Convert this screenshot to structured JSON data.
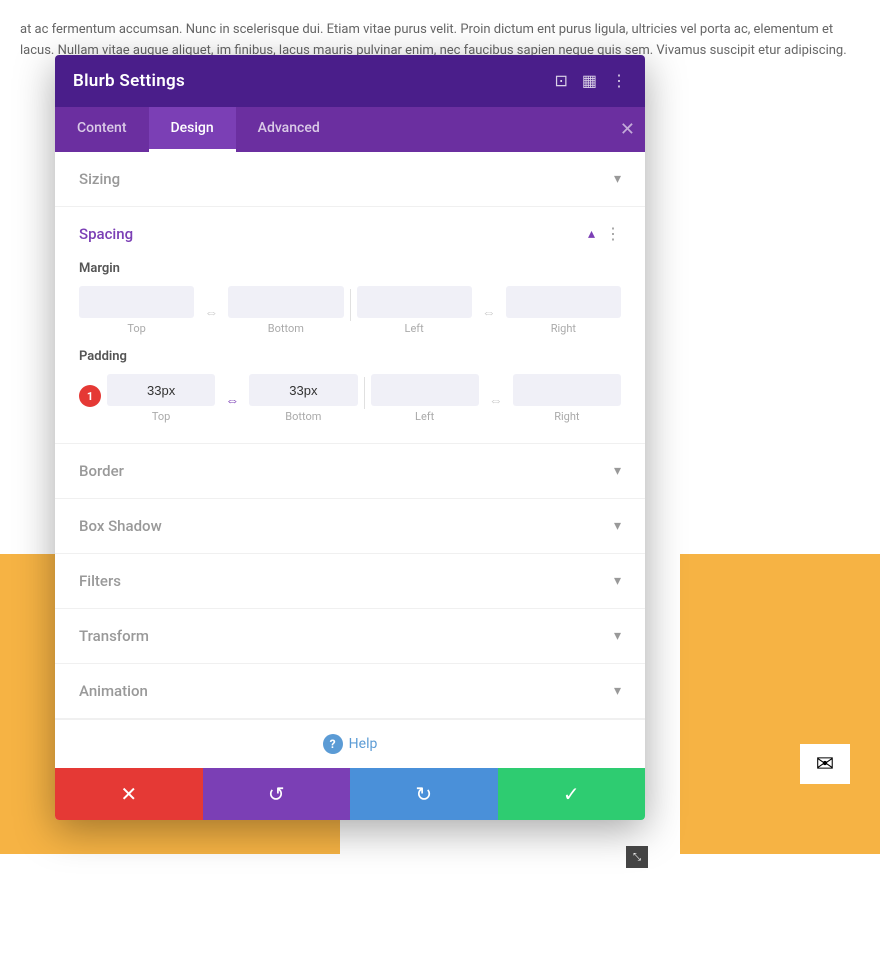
{
  "page": {
    "bg_text": "at ac fermentum accumsan. Nunc in scelerisque dui. Etiam vitae purus velit. Proin dictum ent purus ligula, ultricies vel porta ac, elementum et lacus. Nullam vitae augue aliquet, im finibus, lacus mauris pulvinar enim, nec faucibus sapien neque quis sem. Vivamus suscipit etur adipiscing."
  },
  "modal": {
    "title": "Blurb Settings",
    "tabs": [
      {
        "label": "Content",
        "active": false
      },
      {
        "label": "Design",
        "active": true
      },
      {
        "label": "Advanced",
        "active": false
      }
    ],
    "sections": [
      {
        "label": "Sizing",
        "expanded": false
      },
      {
        "label": "Spacing",
        "expanded": true
      },
      {
        "label": "Border",
        "expanded": false
      },
      {
        "label": "Box Shadow",
        "expanded": false
      },
      {
        "label": "Filters",
        "expanded": false
      },
      {
        "label": "Transform",
        "expanded": false
      },
      {
        "label": "Animation",
        "expanded": false
      }
    ],
    "spacing": {
      "margin": {
        "label": "Margin",
        "top": {
          "value": "",
          "placeholder": ""
        },
        "bottom": {
          "value": "",
          "placeholder": ""
        },
        "left": {
          "value": "",
          "placeholder": ""
        },
        "right": {
          "value": "",
          "placeholder": ""
        }
      },
      "padding": {
        "label": "Padding",
        "badge": "1",
        "top": {
          "value": "33px",
          "placeholder": "33px"
        },
        "bottom": {
          "value": "33px",
          "placeholder": "33px"
        },
        "left": {
          "value": "",
          "placeholder": ""
        },
        "right": {
          "value": "",
          "placeholder": ""
        }
      },
      "labels": {
        "top": "Top",
        "bottom": "Bottom",
        "left": "Left",
        "right": "Right"
      }
    },
    "help_label": "Help",
    "footer_actions": {
      "cancel": "✕",
      "reset": "↺",
      "redo": "↻",
      "save": "✓"
    }
  }
}
